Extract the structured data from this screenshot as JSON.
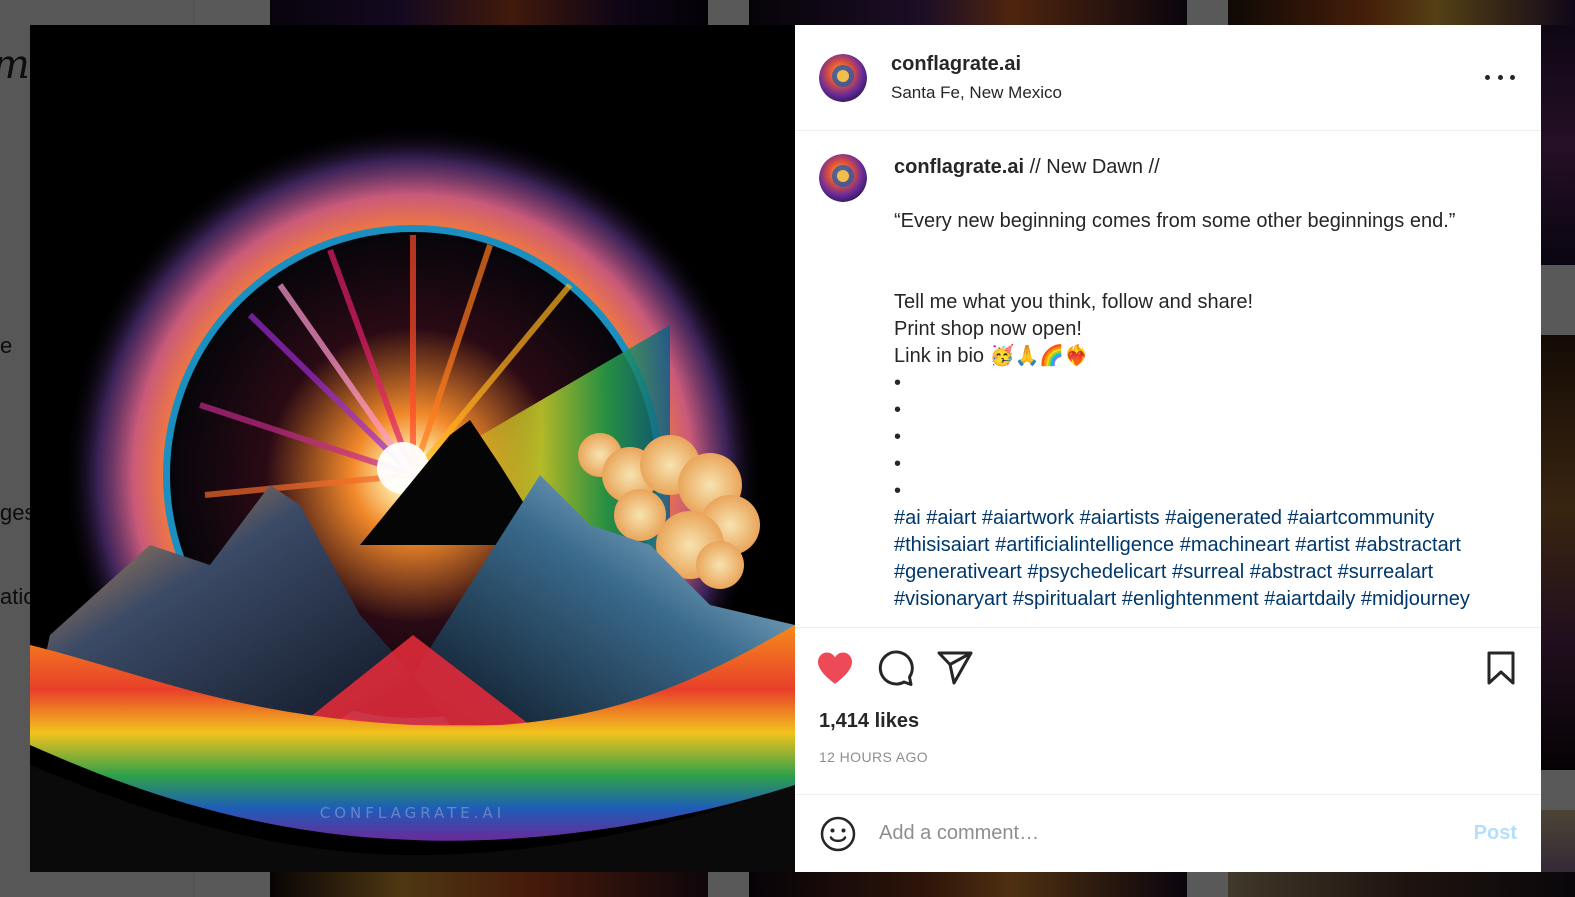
{
  "background": {
    "logo_fragment": "m",
    "nav_fragments": [
      "e",
      "ges",
      "atio"
    ]
  },
  "artwork": {
    "watermark": "CONFLAGRATE.AI"
  },
  "post": {
    "username": "conflagrate.ai",
    "location": "Santa Fe, New Mexico",
    "caption": {
      "username": "conflagrate.ai",
      "title": " // New Dawn //",
      "quote": "“Every new beginning comes from some other beginnings end.”",
      "lines": [
        "Tell me what you think, follow and share!",
        "Print shop now open!",
        "Link in bio 🥳🙏🌈❤️‍🔥"
      ],
      "bullets": [
        "•",
        "•",
        "•",
        "•",
        "•"
      ],
      "hashtag_lines": [
        "#ai #aiart #aiartwork #aiartists #aigenerated #aiartcommunity",
        "#thisisaiart #artificialintelligence #machineart #artist #abstractart",
        "#generativeart #psychedelicart #surreal #abstract #surrealart",
        "#visionaryart #spiritualart #enlightenment #aiartdaily #midjourney"
      ]
    },
    "likes": "1,414 likes",
    "timestamp": "12 HOURS AGO",
    "liked": true,
    "comment_placeholder": "Add a comment…",
    "post_label": "Post"
  },
  "icons": {
    "more": "more-options-icon",
    "heart": "heart-icon",
    "comment": "comment-icon",
    "share": "share-icon",
    "bookmark": "bookmark-icon",
    "emoji": "emoji-icon"
  },
  "colors": {
    "heart": "#ed4956",
    "hashtag": "#00376b",
    "post_disabled": "#b2dffc",
    "timestamp": "#8e8e8e"
  }
}
